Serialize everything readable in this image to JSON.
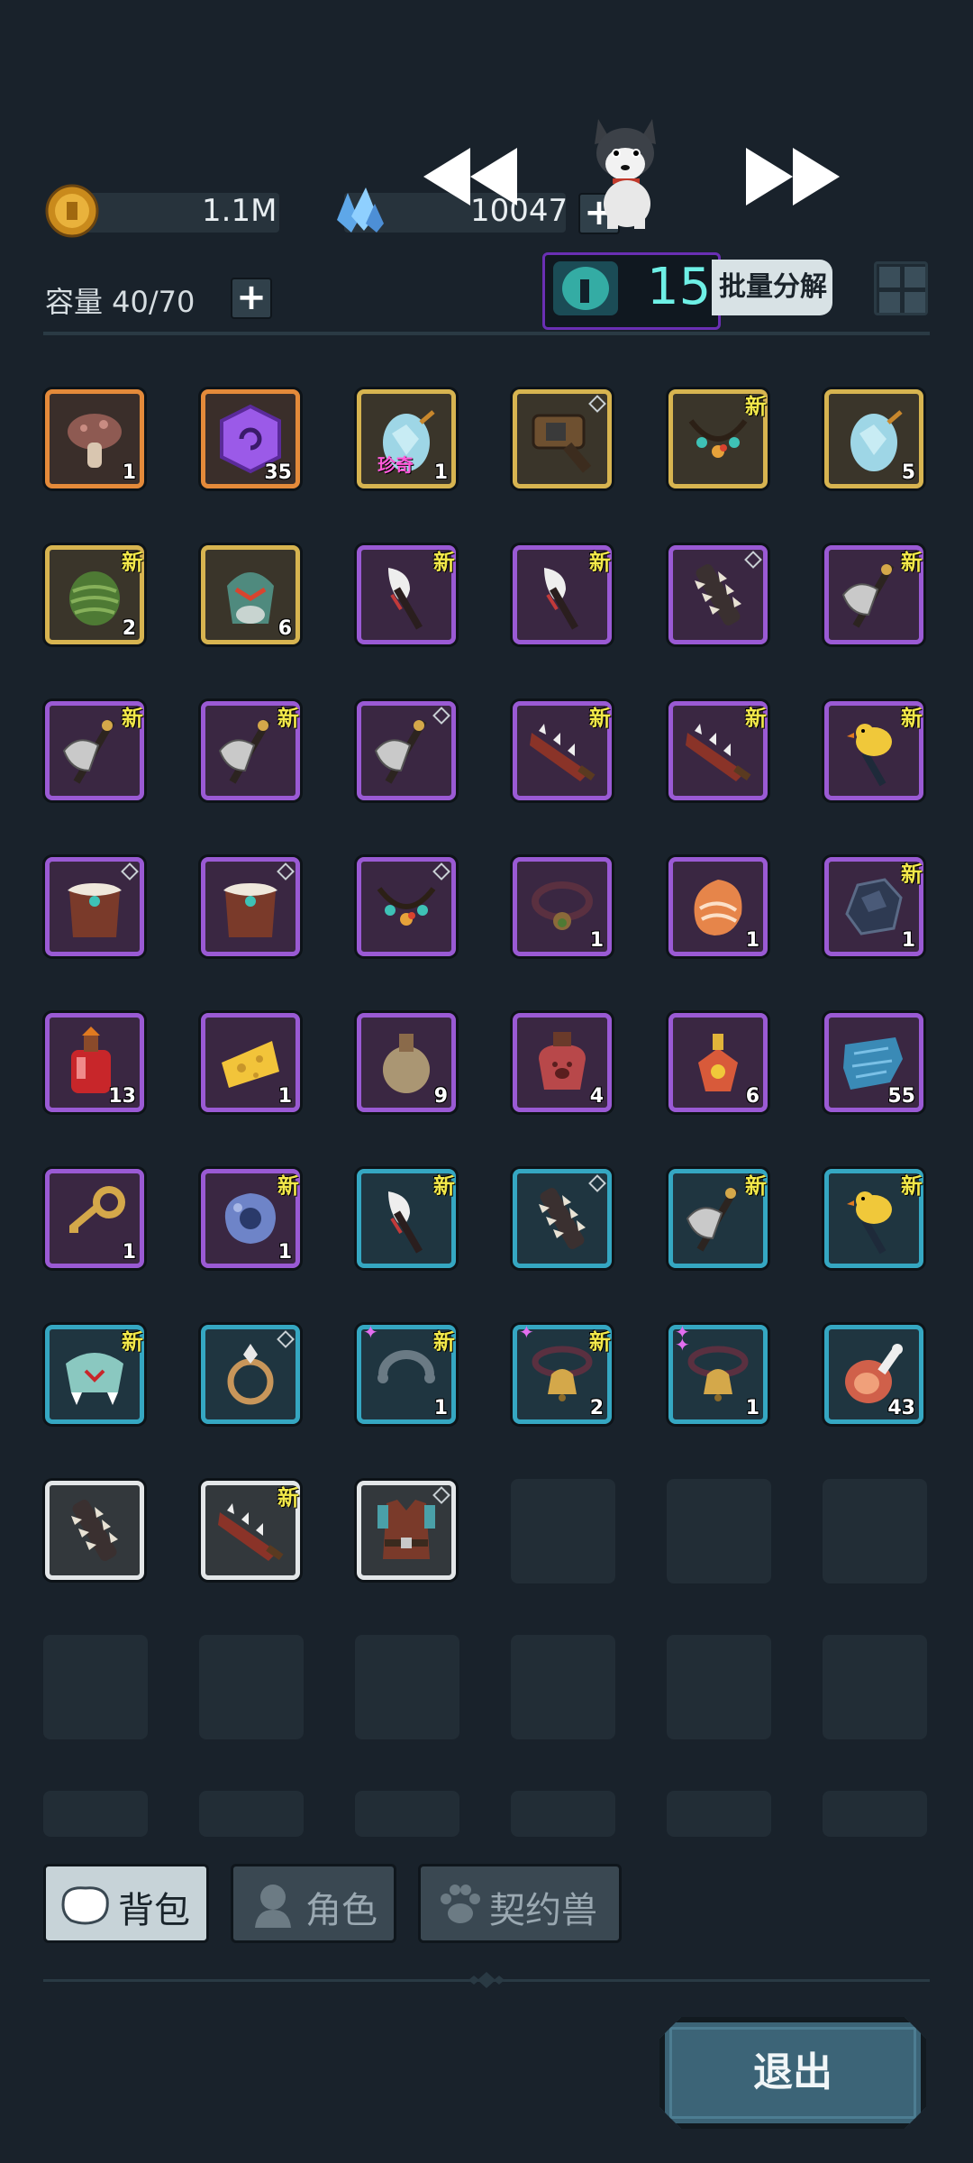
{
  "header": {
    "gold_value": "1.1M",
    "gem_value": "10047",
    "capacity_label": "容量 40/70",
    "batch_count": "15",
    "batch_button": "批量分解"
  },
  "inventory": {
    "slots": [
      {
        "icon": "mushroom-icon",
        "rarity": "orange",
        "count": "1",
        "new": "",
        "mark": ""
      },
      {
        "icon": "purple-rune-icon",
        "rarity": "orange",
        "count": "35",
        "new": "",
        "mark": ""
      },
      {
        "icon": "crystal-egg-icon",
        "rarity": "gold",
        "count": "1",
        "new": "",
        "mark": "",
        "rare": "珍奇"
      },
      {
        "icon": "war-hammer-icon",
        "rarity": "gold",
        "count": "",
        "new": "",
        "mark": "dot"
      },
      {
        "icon": "amulet-icon",
        "rarity": "gold",
        "count": "",
        "new": "新",
        "mark": ""
      },
      {
        "icon": "crystal-egg-icon",
        "rarity": "gold",
        "count": "5",
        "new": "",
        "mark": ""
      },
      {
        "icon": "moss-cocoon-icon",
        "rarity": "gold",
        "count": "2",
        "new": "新",
        "mark": ""
      },
      {
        "icon": "monster-head-icon",
        "rarity": "gold",
        "count": "6",
        "new": "",
        "mark": ""
      },
      {
        "icon": "bone-staff-icon",
        "rarity": "purple",
        "count": "",
        "new": "新",
        "mark": ""
      },
      {
        "icon": "bone-staff-icon",
        "rarity": "purple",
        "count": "",
        "new": "新",
        "mark": ""
      },
      {
        "icon": "spiked-club-icon",
        "rarity": "purple",
        "count": "",
        "new": "",
        "mark": "dot"
      },
      {
        "icon": "battle-axe-icon",
        "rarity": "purple",
        "count": "",
        "new": "新",
        "mark": ""
      },
      {
        "icon": "battle-axe-icon",
        "rarity": "purple",
        "count": "",
        "new": "新",
        "mark": ""
      },
      {
        "icon": "battle-axe-icon",
        "rarity": "purple",
        "count": "",
        "new": "新",
        "mark": ""
      },
      {
        "icon": "battle-axe-icon",
        "rarity": "purple",
        "count": "",
        "new": "",
        "mark": "dot"
      },
      {
        "icon": "jagged-blade-icon",
        "rarity": "purple",
        "count": "",
        "new": "新",
        "mark": ""
      },
      {
        "icon": "jagged-blade-icon",
        "rarity": "purple",
        "count": "",
        "new": "新",
        "mark": ""
      },
      {
        "icon": "duck-mace-icon",
        "rarity": "purple",
        "count": "",
        "new": "新",
        "mark": ""
      },
      {
        "icon": "fur-armor-icon",
        "rarity": "purple",
        "count": "",
        "new": "",
        "mark": "dot"
      },
      {
        "icon": "fur-armor-icon",
        "rarity": "purple",
        "count": "",
        "new": "",
        "mark": "dot"
      },
      {
        "icon": "amulet-icon",
        "rarity": "purple",
        "count": "",
        "new": "",
        "mark": "dot"
      },
      {
        "icon": "collar-icon",
        "rarity": "purple",
        "count": "1",
        "new": "",
        "mark": ""
      },
      {
        "icon": "agate-icon",
        "rarity": "purple",
        "count": "1",
        "new": "",
        "mark": ""
      },
      {
        "icon": "ore-icon",
        "rarity": "purple",
        "count": "1",
        "new": "新",
        "mark": ""
      },
      {
        "icon": "red-potion-icon",
        "rarity": "purple",
        "count": "13",
        "new": "",
        "mark": ""
      },
      {
        "icon": "cheese-icon",
        "rarity": "purple",
        "count": "1",
        "new": "",
        "mark": ""
      },
      {
        "icon": "orange-potion-icon",
        "rarity": "purple",
        "count": "9",
        "new": "",
        "mark": ""
      },
      {
        "icon": "paw-pot-icon",
        "rarity": "purple",
        "count": "4",
        "new": "",
        "mark": ""
      },
      {
        "icon": "gold-potion-icon",
        "rarity": "purple",
        "count": "6",
        "new": "",
        "mark": ""
      },
      {
        "icon": "cloth-icon",
        "rarity": "purple",
        "count": "55",
        "new": "",
        "mark": ""
      },
      {
        "icon": "key-icon",
        "rarity": "purple",
        "count": "1",
        "new": "",
        "mark": ""
      },
      {
        "icon": "blue-ore-icon",
        "rarity": "purple",
        "count": "1",
        "new": "新",
        "mark": ""
      },
      {
        "icon": "bone-staff-icon",
        "rarity": "blue",
        "count": "",
        "new": "新",
        "mark": ""
      },
      {
        "icon": "spiked-club-icon",
        "rarity": "blue",
        "count": "",
        "new": "",
        "mark": "dot"
      },
      {
        "icon": "battle-axe-icon",
        "rarity": "blue",
        "count": "",
        "new": "新",
        "mark": ""
      },
      {
        "icon": "duck-mace-icon",
        "rarity": "blue",
        "count": "",
        "new": "新",
        "mark": ""
      },
      {
        "icon": "fang-helmet-icon",
        "rarity": "blue",
        "count": "",
        "new": "新",
        "mark": ""
      },
      {
        "icon": "ring-icon",
        "rarity": "blue",
        "count": "",
        "new": "",
        "mark": "dot"
      },
      {
        "icon": "bracelet-icon",
        "rarity": "blue",
        "count": "1",
        "new": "新",
        "mark": "star"
      },
      {
        "icon": "bell-collar-icon",
        "rarity": "blue",
        "count": "2",
        "new": "新",
        "mark": "star"
      },
      {
        "icon": "bell-collar-icon",
        "rarity": "blue",
        "count": "1",
        "new": "",
        "mark": "star2"
      },
      {
        "icon": "meat-icon",
        "rarity": "blue",
        "count": "43",
        "new": "",
        "mark": ""
      },
      {
        "icon": "spiked-club-icon",
        "rarity": "white",
        "count": "",
        "new": "",
        "mark": ""
      },
      {
        "icon": "jagged-blade-icon",
        "rarity": "white",
        "count": "",
        "new": "新",
        "mark": ""
      },
      {
        "icon": "leather-vest-icon",
        "rarity": "white",
        "count": "",
        "new": "",
        "mark": "dot"
      }
    ]
  },
  "tabs": [
    {
      "label": "背包",
      "icon": "backpack-icon",
      "active": true
    },
    {
      "label": "角色",
      "icon": "character-icon",
      "active": false
    },
    {
      "label": "契约兽",
      "icon": "paw-icon",
      "active": false
    }
  ],
  "exit_label": "退出",
  "colors": {
    "background": "#19222b",
    "purple": "#9a5ad4",
    "gold": "#d7b450",
    "orange": "#e48a3a",
    "blue": "#35a7c2",
    "white": "#e3e6e8",
    "new_badge": "#f2e84a"
  }
}
